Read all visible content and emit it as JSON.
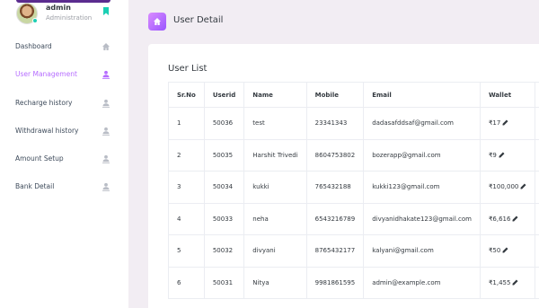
{
  "profile": {
    "name": "admin",
    "role": "Administration"
  },
  "sidebar": {
    "items": [
      {
        "label": "Dashboard",
        "icon": "home-icon"
      },
      {
        "label": "User Management",
        "icon": "user-icon",
        "active": true
      },
      {
        "label": "Recharge history",
        "icon": "user-icon"
      },
      {
        "label": "Withdrawal history",
        "icon": "user-icon"
      },
      {
        "label": "Amount Setup",
        "icon": "user-icon"
      },
      {
        "label": "Bank Detail",
        "icon": "user-icon"
      }
    ]
  },
  "header": {
    "title": "User Detail",
    "icon": "home-icon"
  },
  "card": {
    "title": "User List"
  },
  "table": {
    "headers": [
      "Sr.No",
      "Userid",
      "Name",
      "Mobile",
      "Email",
      "Wallet"
    ],
    "rows": [
      {
        "sr": "1",
        "userid": "50036",
        "name": "test",
        "mobile": "23341343",
        "email": "dadasafddsaf@gmail.com",
        "wallet": "₹17"
      },
      {
        "sr": "2",
        "userid": "50035",
        "name": "Harshit Trivedi",
        "mobile": "8604753802",
        "email": "bozerapp@gmail.com",
        "wallet": "₹9"
      },
      {
        "sr": "3",
        "userid": "50034",
        "name": "kukki",
        "mobile": "765432188",
        "email": "kukki123@gmail.com",
        "wallet": "₹100,000"
      },
      {
        "sr": "4",
        "userid": "50033",
        "name": "neha",
        "mobile": "6543216789",
        "email": "divyanidhakate123@gmail.com",
        "wallet": "₹6,616"
      },
      {
        "sr": "5",
        "userid": "50032",
        "name": "divyani",
        "mobile": "8765432177",
        "email": "kalyani@gmail.com",
        "wallet": "₹50"
      },
      {
        "sr": "6",
        "userid": "50031",
        "name": "Nitya",
        "mobile": "9981861595",
        "email": "admin@example.com",
        "wallet": "₹1,455"
      }
    ]
  },
  "colors": {
    "accent": "#b66dff",
    "brand_dark": "#5b2c8f",
    "online": "#1bcfb4"
  }
}
